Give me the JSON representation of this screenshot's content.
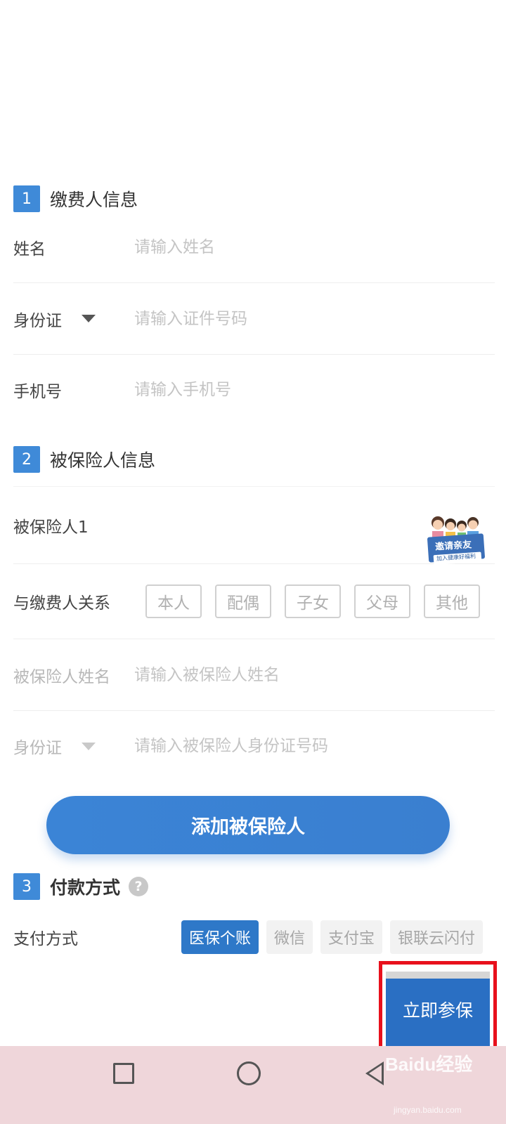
{
  "section1": {
    "num": "1",
    "title": "缴费人信息"
  },
  "payer": {
    "name_label": "姓名",
    "name_placeholder": "请输入姓名",
    "id_label": "身份证",
    "id_placeholder": "请输入证件号码",
    "phone_label": "手机号",
    "phone_placeholder": "请输入手机号"
  },
  "section2": {
    "num": "2",
    "title": "被保险人信息"
  },
  "insured": {
    "header": "被保险人1",
    "invite_text": "邀请亲友",
    "invite_sub": "加入健康好福利",
    "relation_label": "与缴费人关系",
    "relations": [
      "本人",
      "配偶",
      "子女",
      "父母",
      "其他"
    ],
    "name_label": "被保险人姓名",
    "name_placeholder": "请输入被保险人姓名",
    "id_label": "身份证",
    "id_placeholder": "请输入被保险人身份证号码"
  },
  "add_button": "添加被保险人",
  "section3": {
    "num": "3",
    "title": "付款方式",
    "help": "?"
  },
  "payment": {
    "label": "支付方式",
    "options": [
      "医保个账",
      "微信",
      "支付宝",
      "银联云闪付"
    ],
    "selected_index": 0
  },
  "submit_button": "立即参保",
  "watermark": {
    "text": "Baidu经验",
    "sub": "jingyan.baidu.com"
  },
  "colors": {
    "accent": "#3f8ad8",
    "button": "#2a6fc3",
    "highlight": "#e8101c",
    "navbar": "#efd6da"
  },
  "nav_icons": [
    "recent-apps-icon",
    "home-icon",
    "back-icon"
  ]
}
